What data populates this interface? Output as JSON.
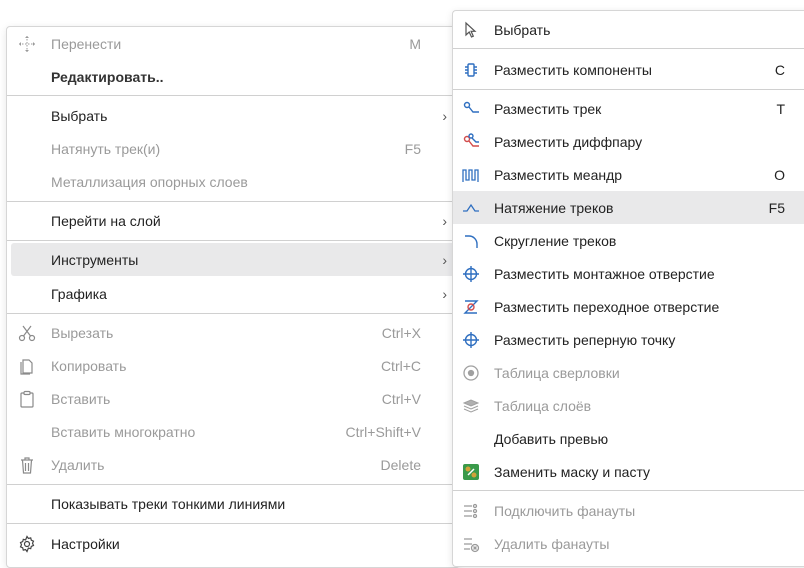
{
  "main_menu": {
    "items": [
      {
        "label": "Перенести",
        "shortcut": "M",
        "icon": "move-icon",
        "disabled": true
      },
      {
        "label": "Редактировать..",
        "shortcut": "",
        "icon": "",
        "bold": true
      },
      {
        "label": "Выбрать",
        "shortcut": "",
        "icon": "",
        "submenu": true
      },
      {
        "label": "Натянуть трек(и)",
        "shortcut": "F5",
        "icon": "",
        "disabled": true
      },
      {
        "label": "Металлизация опорных слоев",
        "shortcut": "",
        "icon": "",
        "disabled": true
      },
      {
        "label": "Перейти на слой",
        "shortcut": "",
        "icon": "",
        "submenu": true
      },
      {
        "label": "Инструменты",
        "shortcut": "",
        "icon": "",
        "submenu": true,
        "hover": true
      },
      {
        "label": "Графика",
        "shortcut": "",
        "icon": "",
        "submenu": true
      },
      {
        "label": "Вырезать",
        "shortcut": "Ctrl+X",
        "icon": "scissors-icon",
        "disabled": true
      },
      {
        "label": "Копировать",
        "shortcut": "Ctrl+C",
        "icon": "copy-icon",
        "disabled": true
      },
      {
        "label": "Вставить",
        "shortcut": "Ctrl+V",
        "icon": "paste-icon",
        "disabled": true
      },
      {
        "label": "Вставить многократно",
        "shortcut": "Ctrl+Shift+V",
        "icon": "",
        "disabled": true
      },
      {
        "label": "Удалить",
        "shortcut": "Delete",
        "icon": "trash-icon",
        "disabled": true
      },
      {
        "label": "Показывать треки тонкими линиями",
        "shortcut": "",
        "icon": ""
      },
      {
        "label": "Настройки",
        "shortcut": "",
        "icon": "gear-icon"
      }
    ],
    "arrow_glyph": "›"
  },
  "sub_menu": {
    "items": [
      {
        "label": "Выбрать",
        "shortcut": "",
        "icon": "cursor-icon"
      },
      {
        "label": "Разместить компоненты",
        "shortcut": "C",
        "icon": "component-icon"
      },
      {
        "label": "Разместить трек",
        "shortcut": "T",
        "icon": "track-icon"
      },
      {
        "label": "Разместить диффпару",
        "shortcut": "",
        "icon": "diffpair-icon"
      },
      {
        "label": "Разместить меандр",
        "shortcut": "O",
        "icon": "meander-icon"
      },
      {
        "label": "Натяжение треков",
        "shortcut": "F5",
        "icon": "tension-icon",
        "hover": true
      },
      {
        "label": "Скругление треков",
        "shortcut": "",
        "icon": "rounding-icon"
      },
      {
        "label": "Разместить монтажное отверстие",
        "shortcut": "",
        "icon": "mounting-hole-icon"
      },
      {
        "label": "Разместить переходное отверстие",
        "shortcut": "",
        "icon": "via-icon"
      },
      {
        "label": "Разместить реперную точку",
        "shortcut": "",
        "icon": "fiducial-icon"
      },
      {
        "label": "Таблица сверловки",
        "shortcut": "",
        "icon": "drill-table-icon",
        "disabled": true
      },
      {
        "label": "Таблица слоёв",
        "shortcut": "",
        "icon": "layer-table-icon",
        "disabled": true
      },
      {
        "label": "Добавить превью",
        "shortcut": "",
        "icon": ""
      },
      {
        "label": "Заменить маску и пасту",
        "shortcut": "",
        "icon": "mask-paste-icon"
      },
      {
        "label": "Подключить фанауты",
        "shortcut": "",
        "icon": "fanout-connect-icon",
        "disabled": true
      },
      {
        "label": "Удалить фанауты",
        "shortcut": "",
        "icon": "fanout-delete-icon",
        "disabled": true
      }
    ]
  },
  "colors": {
    "hover_bg": "#e9e9ea",
    "accent_blue": "#2f6fc0",
    "disabled_text": "#9a9a9a"
  }
}
